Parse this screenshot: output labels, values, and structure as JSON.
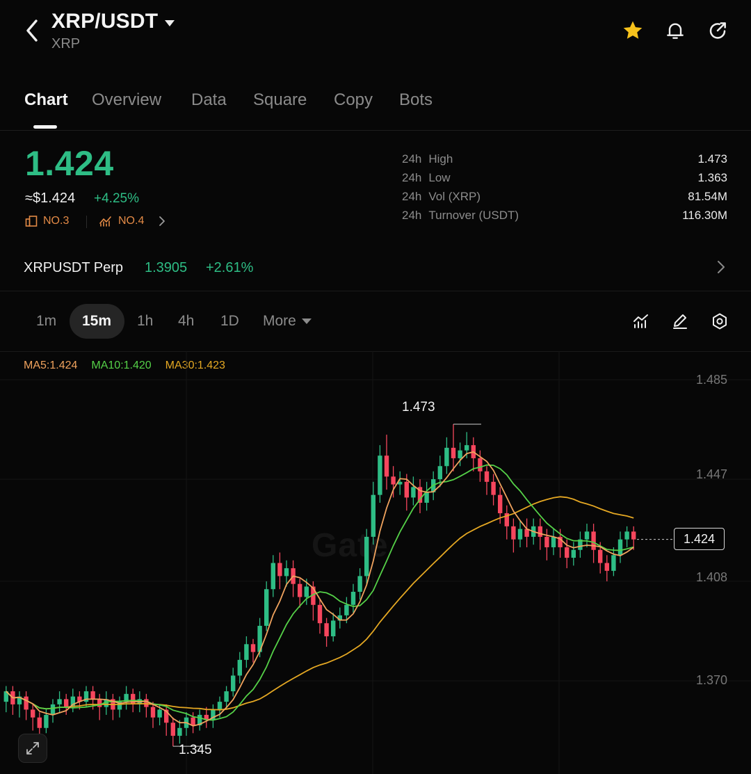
{
  "header": {
    "title": "XRP/USDT",
    "subtitle": "XRP",
    "icons": [
      "back-chevron",
      "star-icon",
      "bell-icon",
      "share-icon"
    ],
    "favorite": true
  },
  "tabs": [
    {
      "label": "Chart",
      "active": true
    },
    {
      "label": "Overview"
    },
    {
      "label": "Data"
    },
    {
      "label": "Square"
    },
    {
      "label": "Copy"
    },
    {
      "label": "Bots"
    }
  ],
  "price": {
    "last": "1.424",
    "usd": "≈$1.424",
    "change_pct": "+4.25%",
    "rank1": "NO.3",
    "rank2": "NO.4"
  },
  "stats": [
    {
      "label": "24h",
      "name": "High",
      "value": "1.473"
    },
    {
      "label": "24h",
      "name": "Low",
      "value": "1.363"
    },
    {
      "label": "24h",
      "name": "Vol (XRP)",
      "value": "81.54M"
    },
    {
      "label": "24h",
      "name": "Turnover (USDT)",
      "value": "116.30M"
    }
  ],
  "perp": {
    "name": "XRPUSDT Perp",
    "price": "1.3905",
    "change": "+2.61%"
  },
  "intervals": [
    {
      "label": "1m"
    },
    {
      "label": "15m",
      "active": true
    },
    {
      "label": "1h"
    },
    {
      "label": "4h"
    },
    {
      "label": "1D"
    },
    {
      "label": "More"
    }
  ],
  "indicators": {
    "ma5": "MA5:1.424",
    "ma10": "MA10:1.420",
    "ma30": "MA30:1.423"
  },
  "colors": {
    "up": "#2ebd85",
    "down": "#f6465d",
    "ma5": "#f0a35e",
    "ma10": "#55d148",
    "ma30": "#e5a823",
    "rank": "#e38a46"
  },
  "chart_data": {
    "type": "candlestick",
    "y_ticks": [
      "1.485",
      "1.447",
      "1.408",
      "1.370"
    ],
    "ylim": [
      1.34,
      1.49
    ],
    "last_price_tag": "1.424",
    "high_marker": "1.473",
    "low_marker": "1.345",
    "watermark": "Gate",
    "candles": [
      [
        1.362,
        1.366,
        1.358,
        1.368
      ],
      [
        1.366,
        1.361,
        1.357,
        1.368
      ],
      [
        1.361,
        1.364,
        1.356,
        1.366
      ],
      [
        1.364,
        1.359,
        1.355,
        1.366
      ],
      [
        1.359,
        1.356,
        1.351,
        1.361
      ],
      [
        1.356,
        1.352,
        1.348,
        1.358
      ],
      [
        1.352,
        1.357,
        1.35,
        1.359
      ],
      [
        1.357,
        1.361,
        1.354,
        1.363
      ],
      [
        1.361,
        1.363,
        1.358,
        1.366
      ],
      [
        1.363,
        1.36,
        1.357,
        1.365
      ],
      [
        1.36,
        1.364,
        1.358,
        1.367
      ],
      [
        1.364,
        1.362,
        1.359,
        1.366
      ],
      [
        1.362,
        1.366,
        1.36,
        1.368
      ],
      [
        1.366,
        1.363,
        1.359,
        1.368
      ],
      [
        1.363,
        1.36,
        1.355,
        1.365
      ],
      [
        1.36,
        1.363,
        1.357,
        1.366
      ],
      [
        1.363,
        1.359,
        1.355,
        1.365
      ],
      [
        1.359,
        1.362,
        1.356,
        1.364
      ],
      [
        1.362,
        1.365,
        1.359,
        1.368
      ],
      [
        1.365,
        1.361,
        1.358,
        1.367
      ],
      [
        1.361,
        1.363,
        1.358,
        1.366
      ],
      [
        1.363,
        1.36,
        1.356,
        1.365
      ],
      [
        1.36,
        1.356,
        1.352,
        1.362
      ],
      [
        1.356,
        1.359,
        1.353,
        1.361
      ],
      [
        1.359,
        1.354,
        1.349,
        1.361
      ],
      [
        1.354,
        1.349,
        1.345,
        1.356
      ],
      [
        1.349,
        1.352,
        1.346,
        1.355
      ],
      [
        1.352,
        1.356,
        1.349,
        1.358
      ],
      [
        1.356,
        1.353,
        1.35,
        1.358
      ],
      [
        1.353,
        1.357,
        1.351,
        1.359
      ],
      [
        1.357,
        1.355,
        1.352,
        1.36
      ],
      [
        1.355,
        1.359,
        1.352,
        1.361
      ],
      [
        1.359,
        1.362,
        1.356,
        1.364
      ],
      [
        1.362,
        1.366,
        1.359,
        1.368
      ],
      [
        1.366,
        1.372,
        1.364,
        1.375
      ],
      [
        1.372,
        1.378,
        1.369,
        1.381
      ],
      [
        1.378,
        1.384,
        1.375,
        1.387
      ],
      [
        1.384,
        1.381,
        1.377,
        1.386
      ],
      [
        1.381,
        1.391,
        1.379,
        1.394
      ],
      [
        1.391,
        1.405,
        1.389,
        1.408
      ],
      [
        1.405,
        1.415,
        1.402,
        1.418
      ],
      [
        1.415,
        1.41,
        1.405,
        1.419
      ],
      [
        1.41,
        1.413,
        1.406,
        1.416
      ],
      [
        1.413,
        1.407,
        1.402,
        1.416
      ],
      [
        1.407,
        1.402,
        1.398,
        1.409
      ],
      [
        1.402,
        1.406,
        1.399,
        1.409
      ],
      [
        1.406,
        1.399,
        1.393,
        1.408
      ],
      [
        1.399,
        1.392,
        1.388,
        1.401
      ],
      [
        1.392,
        1.387,
        1.383,
        1.394
      ],
      [
        1.387,
        1.393,
        1.385,
        1.396
      ],
      [
        1.393,
        1.395,
        1.39,
        1.398
      ],
      [
        1.395,
        1.399,
        1.392,
        1.402
      ],
      [
        1.399,
        1.404,
        1.396,
        1.407
      ],
      [
        1.404,
        1.41,
        1.401,
        1.413
      ],
      [
        1.41,
        1.425,
        1.407,
        1.428
      ],
      [
        1.425,
        1.441,
        1.422,
        1.446
      ],
      [
        1.441,
        1.456,
        1.438,
        1.46
      ],
      [
        1.456,
        1.448,
        1.443,
        1.464
      ],
      [
        1.448,
        1.445,
        1.44,
        1.452
      ],
      [
        1.445,
        1.446,
        1.441,
        1.45
      ],
      [
        1.446,
        1.44,
        1.435,
        1.449
      ],
      [
        1.44,
        1.444,
        1.437,
        1.448
      ],
      [
        1.444,
        1.438,
        1.434,
        1.447
      ],
      [
        1.438,
        1.442,
        1.435,
        1.446
      ],
      [
        1.442,
        1.447,
        1.439,
        1.45
      ],
      [
        1.447,
        1.452,
        1.444,
        1.456
      ],
      [
        1.452,
        1.459,
        1.449,
        1.463
      ],
      [
        1.459,
        1.455,
        1.45,
        1.468
      ],
      [
        1.455,
        1.458,
        1.452,
        1.461
      ],
      [
        1.458,
        1.46,
        1.455,
        1.465
      ],
      [
        1.46,
        1.455,
        1.45,
        1.463
      ],
      [
        1.455,
        1.45,
        1.446,
        1.458
      ],
      [
        1.45,
        1.446,
        1.441,
        1.452
      ],
      [
        1.446,
        1.441,
        1.437,
        1.449
      ],
      [
        1.441,
        1.434,
        1.43,
        1.444
      ],
      [
        1.434,
        1.429,
        1.424,
        1.437
      ],
      [
        1.429,
        1.424,
        1.419,
        1.432
      ],
      [
        1.424,
        1.428,
        1.421,
        1.431
      ],
      [
        1.428,
        1.425,
        1.421,
        1.432
      ],
      [
        1.425,
        1.429,
        1.422,
        1.432
      ],
      [
        1.429,
        1.425,
        1.42,
        1.432
      ],
      [
        1.425,
        1.421,
        1.416,
        1.428
      ],
      [
        1.421,
        1.425,
        1.418,
        1.428
      ],
      [
        1.425,
        1.421,
        1.417,
        1.428
      ],
      [
        1.421,
        1.417,
        1.413,
        1.424
      ],
      [
        1.417,
        1.42,
        1.414,
        1.423
      ],
      [
        1.42,
        1.424,
        1.417,
        1.427
      ],
      [
        1.424,
        1.427,
        1.421,
        1.43
      ],
      [
        1.427,
        1.42,
        1.415,
        1.43
      ],
      [
        1.42,
        1.415,
        1.411,
        1.423
      ],
      [
        1.415,
        1.412,
        1.408,
        1.418
      ],
      [
        1.412,
        1.418,
        1.41,
        1.421
      ],
      [
        1.418,
        1.424,
        1.415,
        1.427
      ],
      [
        1.424,
        1.427,
        1.421,
        1.429
      ],
      [
        1.427,
        1.424,
        1.42,
        1.429
      ]
    ],
    "ma5": "orange moving average line",
    "ma10": "green moving average line",
    "ma30": "yellow moving average line"
  }
}
